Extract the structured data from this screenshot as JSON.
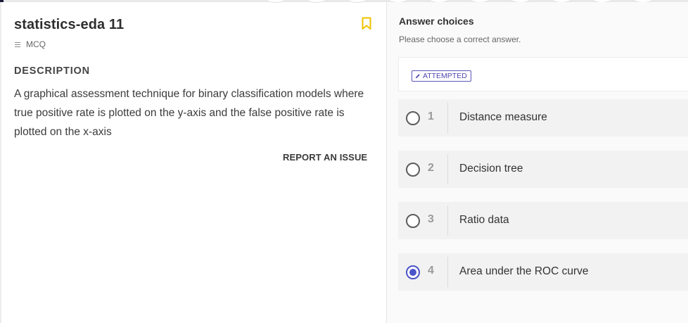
{
  "question": {
    "title": "statistics-eda 11",
    "type": "MCQ",
    "section_label": "DESCRIPTION",
    "description": "A graphical assessment technique for binary classification models where true positive rate is plotted on the y-axis and the false positive rate is plotted on the x-axis",
    "report_label": "REPORT AN ISSUE",
    "bookmark_icon": "bookmark-icon",
    "accent_color": "#f2c200"
  },
  "answers": {
    "heading": "Answer choices",
    "subheading": "Please choose a correct answer.",
    "status": "ATTEMPTED",
    "status_color": "#4f48ad",
    "selected_color": "#4b55c9",
    "options": [
      {
        "number": "1",
        "text": "Distance measure",
        "selected": false
      },
      {
        "number": "2",
        "text": "Decision tree",
        "selected": false
      },
      {
        "number": "3",
        "text": "Ratio data",
        "selected": false
      },
      {
        "number": "4",
        "text": "Area under the ROC curve",
        "selected": true
      }
    ]
  }
}
